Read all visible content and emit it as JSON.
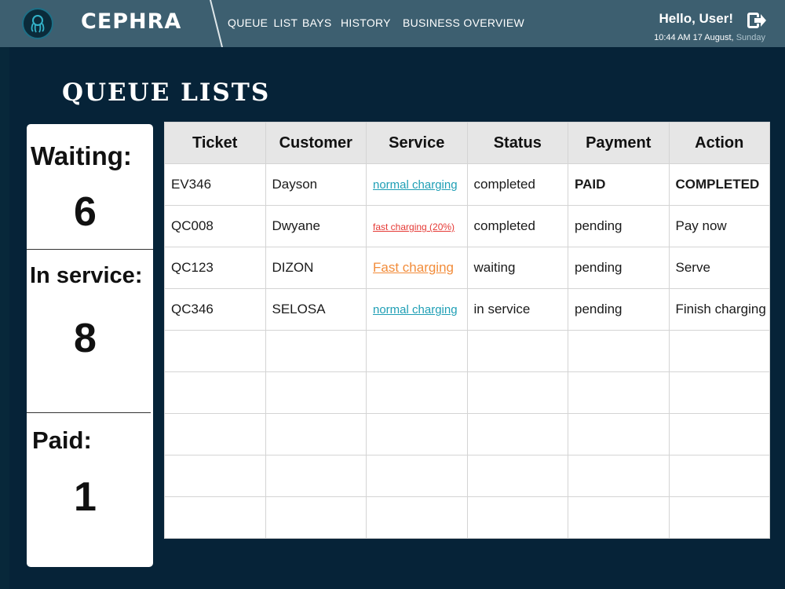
{
  "header": {
    "brand": "CEPHRA",
    "nav": {
      "queue_list": "QUEUE  LIST",
      "bays": "BAYS",
      "history": "HISTORY",
      "business_overview": "BUSINESS OVERVIEW"
    },
    "greeting": "Hello, User!",
    "datetime": "10:44 AM 17 August,",
    "day": "Sunday"
  },
  "page_title": "QUEUE LISTS",
  "stats": {
    "waiting_label": "Waiting:",
    "waiting_value": "6",
    "in_service_label": "In service:",
    "in_service_value": "8",
    "paid_label": "Paid:",
    "paid_value": "1"
  },
  "table": {
    "columns": [
      "Ticket",
      "Customer",
      "Service",
      "Status",
      "Payment",
      "Action"
    ],
    "rows": [
      {
        "ticket": "EV346",
        "customer": "Dayson",
        "service": "normal charging",
        "status": "completed",
        "payment": "PAID",
        "action": "COMPLETED"
      },
      {
        "ticket": "QC008",
        "customer": "Dwyane",
        "service": "fast charging (20%)",
        "status": "completed",
        "payment": "pending",
        "action": "Pay now"
      },
      {
        "ticket": "QC123",
        "customer": "DIZON",
        "service": "Fast charging",
        "status": "waiting",
        "payment": "pending",
        "action": "Serve"
      },
      {
        "ticket": "QC346",
        "customer": "SELOSA",
        "service": "normal charging",
        "status": "in service",
        "payment": "pending",
        "action": "Finish charging"
      }
    ]
  },
  "colors": {
    "topbar": "#3d5f70",
    "background": "#062338",
    "paid_green": "#1fc46b",
    "link_blue": "#1f9fb5",
    "link_red": "#e53935",
    "link_orange": "#f28c3a"
  },
  "icons": {
    "logo": "octopus-logo-icon",
    "logout": "logout-icon"
  }
}
